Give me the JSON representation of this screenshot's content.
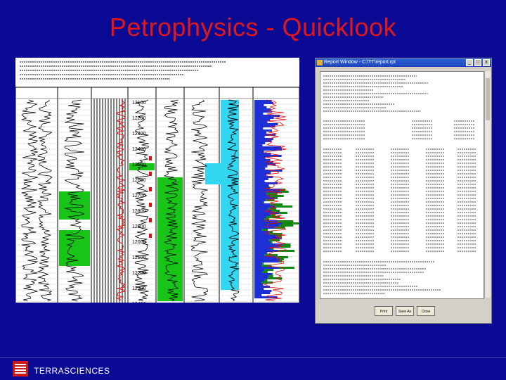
{
  "slide": {
    "title": "Petrophysics - Quicklook",
    "footer_brand": "TERRASCIENCES"
  },
  "log_panel": {
    "depth_labels": [
      "12100",
      "12200",
      "12300",
      "12400",
      "12500",
      "12600",
      "12700",
      "12800",
      "12900",
      "12000",
      "12100",
      "12200",
      "12300",
      "12400"
    ]
  },
  "report_window": {
    "title": "Report Window - C:\\TT\\report.rpt",
    "buttons": [
      "Print",
      "Save As",
      "Close"
    ]
  },
  "colors": {
    "background": "#0a0a95",
    "title": "#e01818",
    "green_fill": "#19c419",
    "cyan_fill": "#32d6f0",
    "blue_fill": "#1e2fd6",
    "red_curve": "#e01010",
    "logo": "#d01818"
  }
}
